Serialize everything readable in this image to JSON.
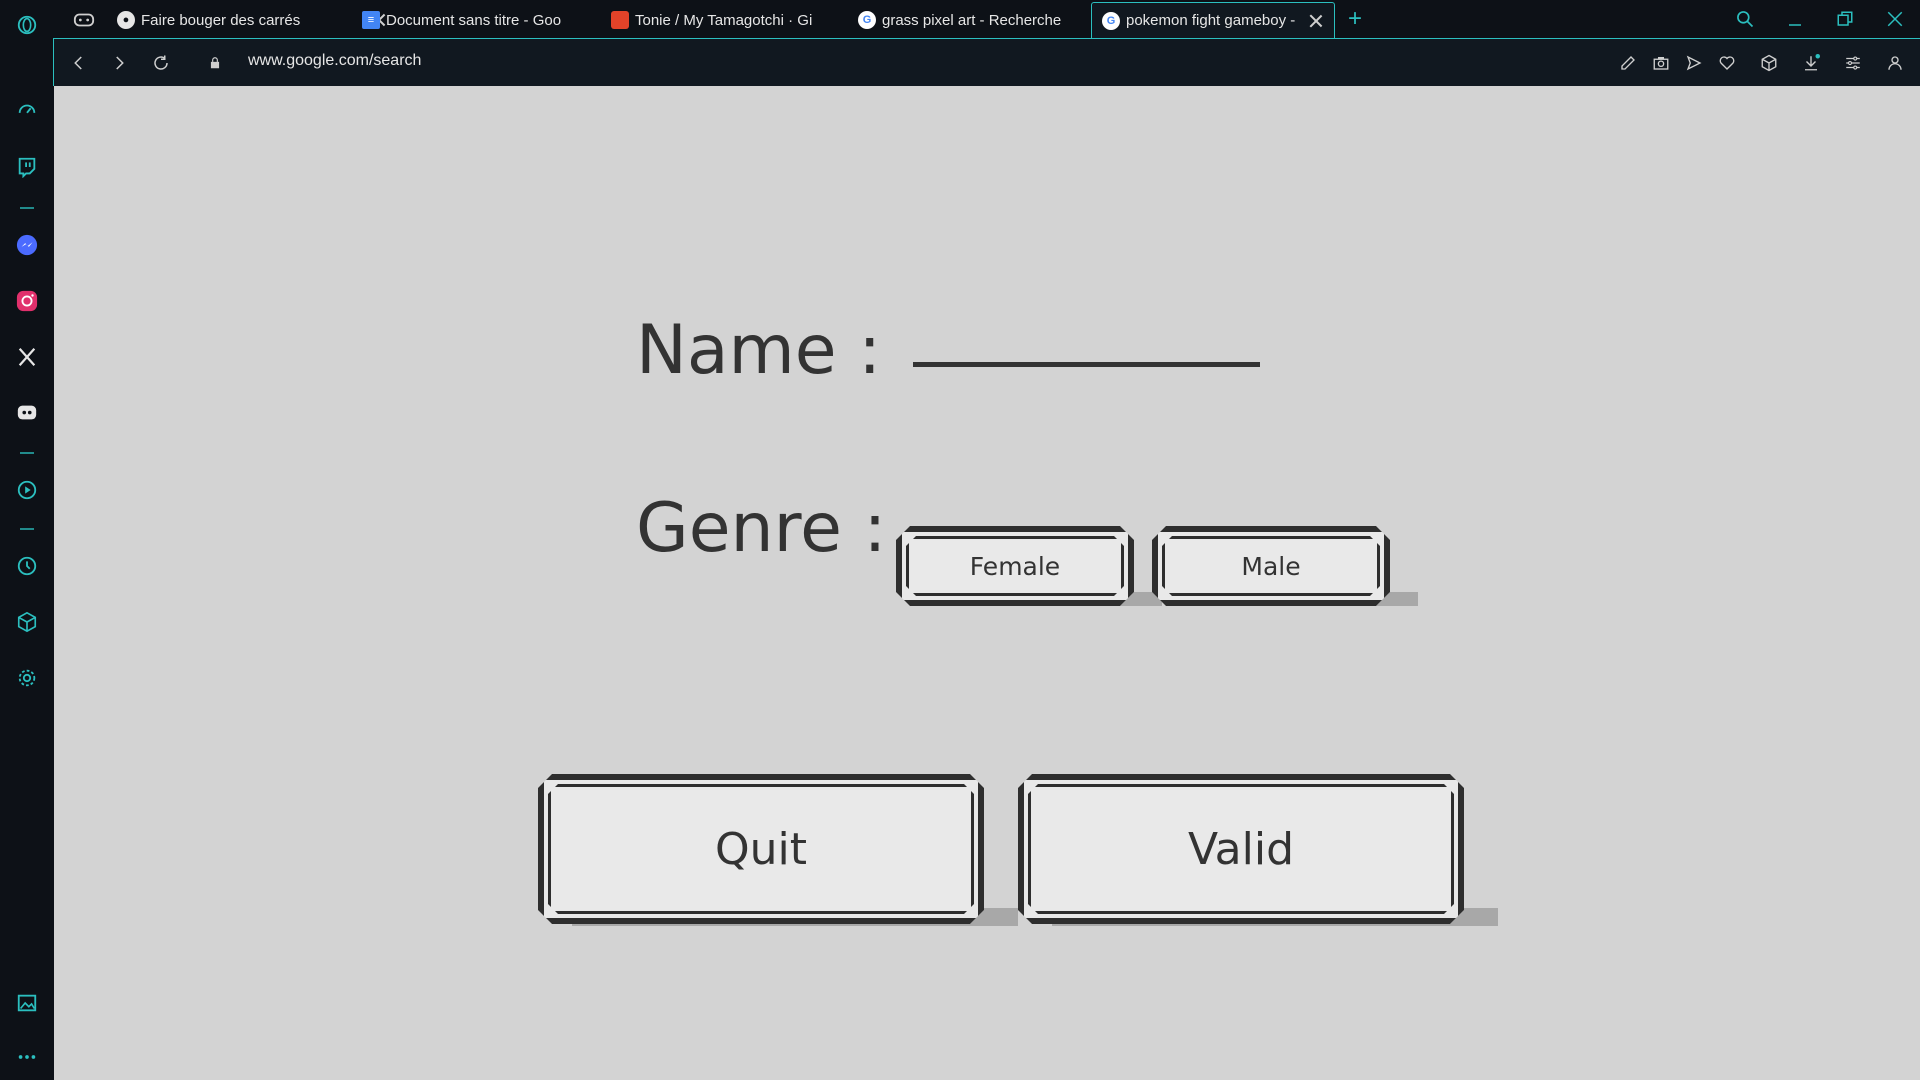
{
  "browser": {
    "tabs": [
      {
        "title": "Faire bouger des carrés",
        "favicon": "globe-icon"
      },
      {
        "title": "Document sans titre - Goo",
        "favicon": "docs-icon"
      },
      {
        "title": "Tonie / My Tamagotchi · Gi",
        "favicon": "gitlab-icon"
      },
      {
        "title": "grass pixel art - Recherche",
        "favicon": "google-icon"
      },
      {
        "title": "pokemon fight gameboy -",
        "favicon": "google-icon"
      }
    ],
    "url": "www.google.com/search",
    "accent_color": "#2bbfbf"
  },
  "form": {
    "name_label": "Name :",
    "name_value": "",
    "genre_label": "Genre :",
    "female_label": "Female",
    "male_label": "Male",
    "quit_label": "Quit",
    "valid_label": "Valid"
  }
}
